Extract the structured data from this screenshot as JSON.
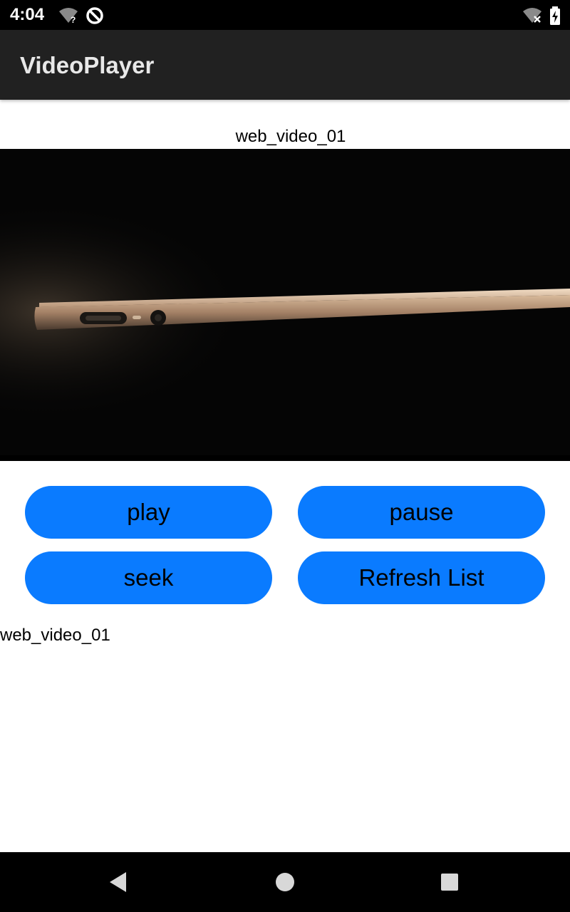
{
  "status_bar": {
    "time": "4:04",
    "icons": [
      "wifi-unknown-icon",
      "data-saver-icon",
      "wifi-off-icon",
      "battery-charging-icon"
    ]
  },
  "app_bar": {
    "title": "VideoPlayer"
  },
  "player": {
    "video_title": "web_video_01",
    "frame_description_icon": "laptop-side-view"
  },
  "controls": {
    "play_label": "play",
    "pause_label": "pause",
    "seek_label": "seek",
    "refresh_label": "Refresh List"
  },
  "video_list": [
    {
      "name": "web_video_01"
    }
  ],
  "navigation": {
    "icons": [
      "back-icon",
      "home-icon",
      "recents-icon"
    ]
  },
  "colors": {
    "status_bar": "#000000",
    "app_bar": "#212121",
    "button": "#0a7bff",
    "nav_bar": "#000000",
    "video_background": "#050505"
  }
}
